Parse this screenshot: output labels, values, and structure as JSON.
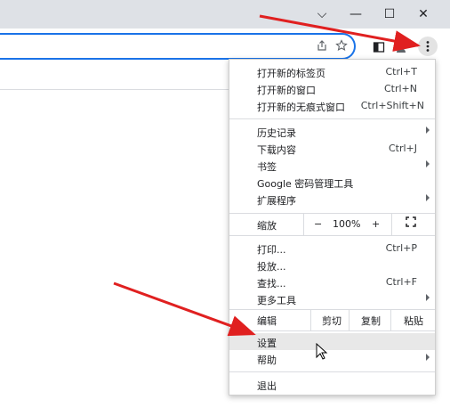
{
  "window": {
    "minimize": "—",
    "chevron": "⌵",
    "maximize": "☐",
    "close": "✕"
  },
  "toolbar": {
    "share_icon": "share-icon",
    "star_icon": "star-icon",
    "sidepanel_icon": "side-panel-icon",
    "profile_icon": "profile-icon",
    "menu_icon": "menu-dots-icon"
  },
  "menu": {
    "items": [
      {
        "label": "打开新的标签页",
        "shortcut": "Ctrl+T"
      },
      {
        "label": "打开新的窗口",
        "shortcut": "Ctrl+N"
      },
      {
        "label": "打开新的无痕式窗口",
        "shortcut": "Ctrl+Shift+N"
      },
      {
        "label": "历史记录",
        "shortcut": ""
      },
      {
        "label": "下载内容",
        "shortcut": "Ctrl+J"
      },
      {
        "label": "书签",
        "shortcut": ""
      },
      {
        "label": "Google 密码管理工具",
        "shortcut": ""
      },
      {
        "label": "扩展程序",
        "shortcut": ""
      },
      {
        "label": "打印...",
        "shortcut": "Ctrl+P"
      },
      {
        "label": "投放...",
        "shortcut": ""
      },
      {
        "label": "查找...",
        "shortcut": "Ctrl+F"
      },
      {
        "label": "更多工具",
        "shortcut": ""
      },
      {
        "label": "设置",
        "shortcut": ""
      },
      {
        "label": "帮助",
        "shortcut": ""
      },
      {
        "label": "退出",
        "shortcut": ""
      }
    ],
    "zoom": {
      "label": "缩放",
      "minus": "−",
      "value": "100%",
      "plus": "+",
      "fullscreen": "⛶"
    },
    "edit": {
      "label": "编辑",
      "cut": "剪切",
      "copy": "复制",
      "paste": "粘贴"
    }
  },
  "annotation_color": "#e02020"
}
